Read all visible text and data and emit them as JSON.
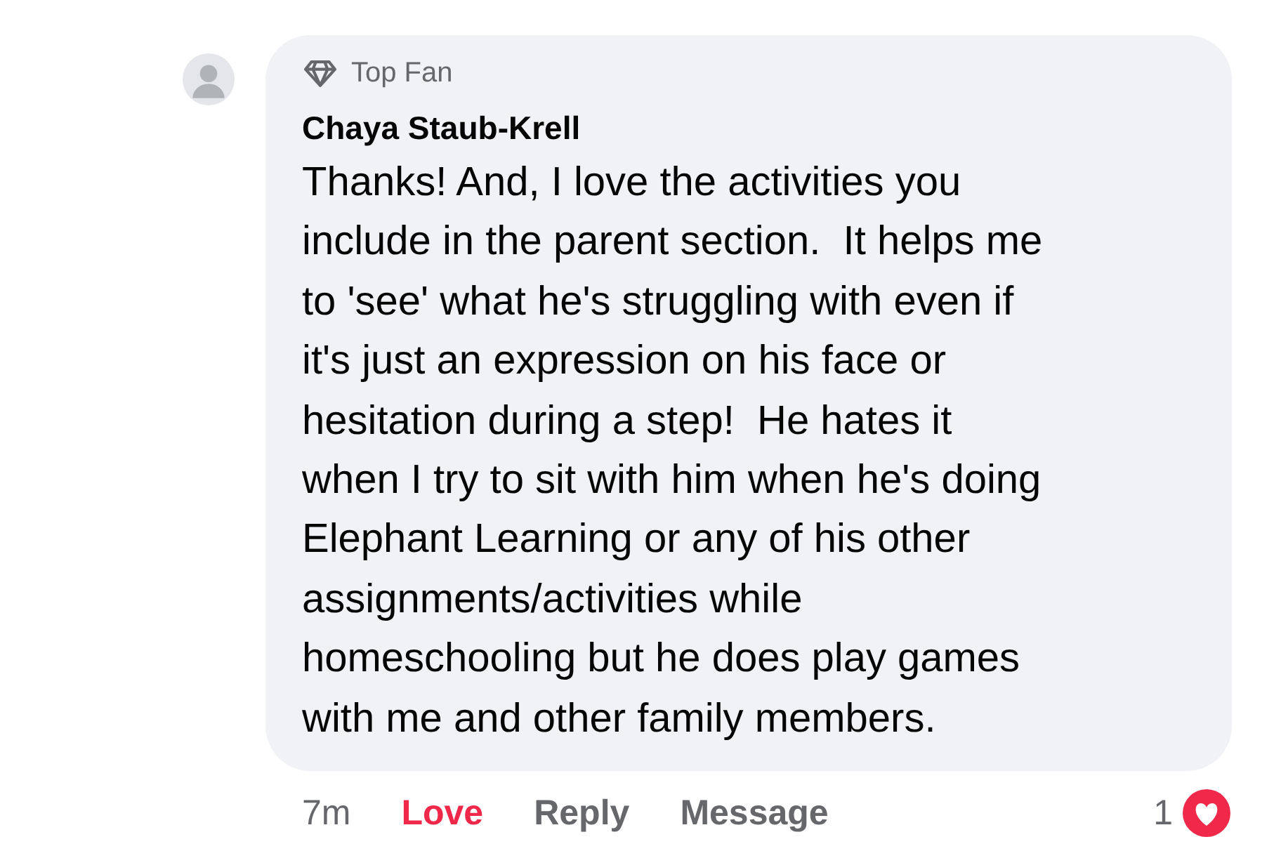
{
  "comment": {
    "badge": "Top Fan",
    "author": "Chaya Staub-Krell",
    "text": "Thanks! And, I love the activities you\ninclude in the parent section.  It helps me\nto 'see' what he's struggling with even if\nit's just an expression on his face or\nhesitation during a step!  He hates it\nwhen I try to sit with him when he's doing\nElephant Learning or any of his other\nassignments/activities while\nhomeschooling but he does play games\nwith me and other family members."
  },
  "footer": {
    "time": "7m",
    "actions": [
      {
        "label": "Love",
        "selected": true
      },
      {
        "label": "Reply",
        "selected": false
      },
      {
        "label": "Message",
        "selected": false
      }
    ],
    "reaction_count": "1"
  }
}
